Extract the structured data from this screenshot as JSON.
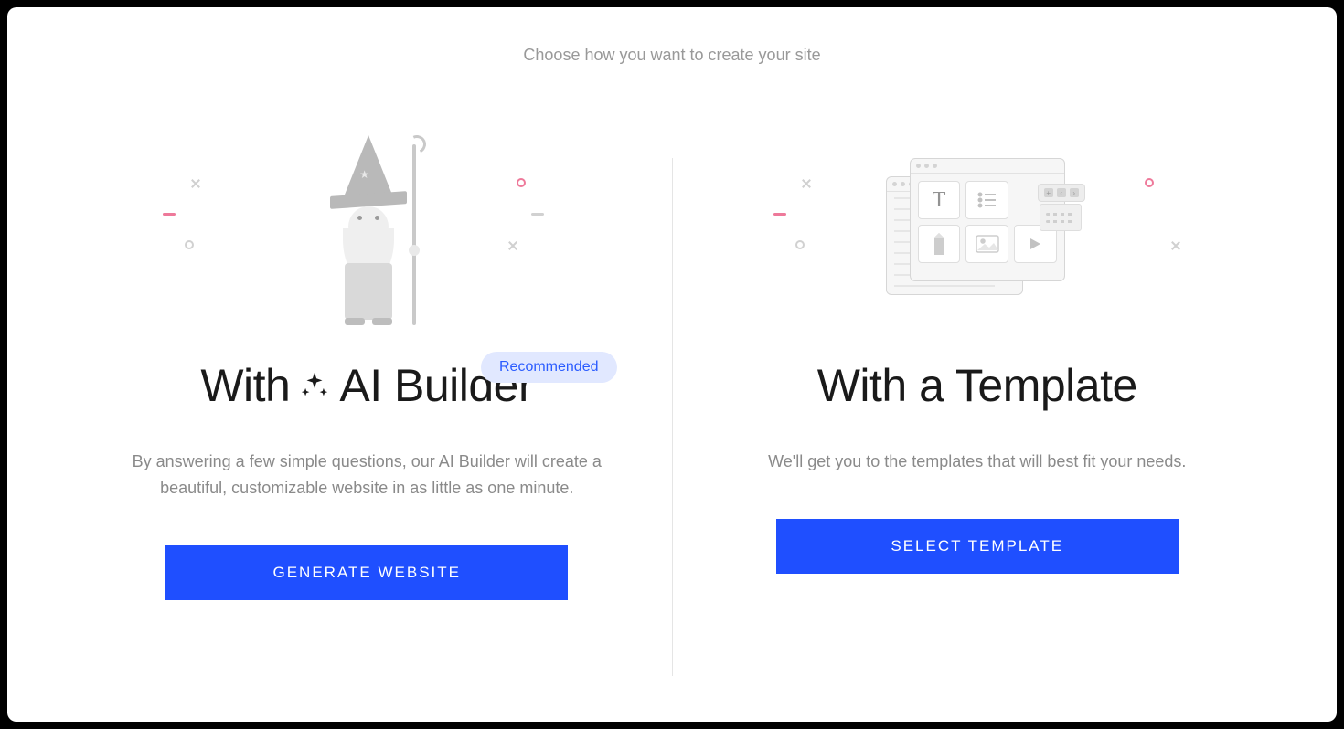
{
  "header": {
    "subtitle": "Choose how you want to create your site"
  },
  "options": {
    "ai": {
      "badge": "Recommended",
      "title_prefix": "With",
      "title_suffix": "AI Builder",
      "description": "By answering a few simple questions, our AI Builder will create a beautiful, customizable website in as little as one minute.",
      "cta": "GENERATE WEBSITE"
    },
    "template": {
      "title": "With a Template",
      "description": "We'll get you to the templates that will best fit your needs.",
      "cta": "SELECT TEMPLATE"
    }
  },
  "colors": {
    "primary": "#1f4fff",
    "badge_bg": "#e1e8ff",
    "badge_text": "#2a5bff",
    "accent_pink": "#ec6a8f"
  }
}
